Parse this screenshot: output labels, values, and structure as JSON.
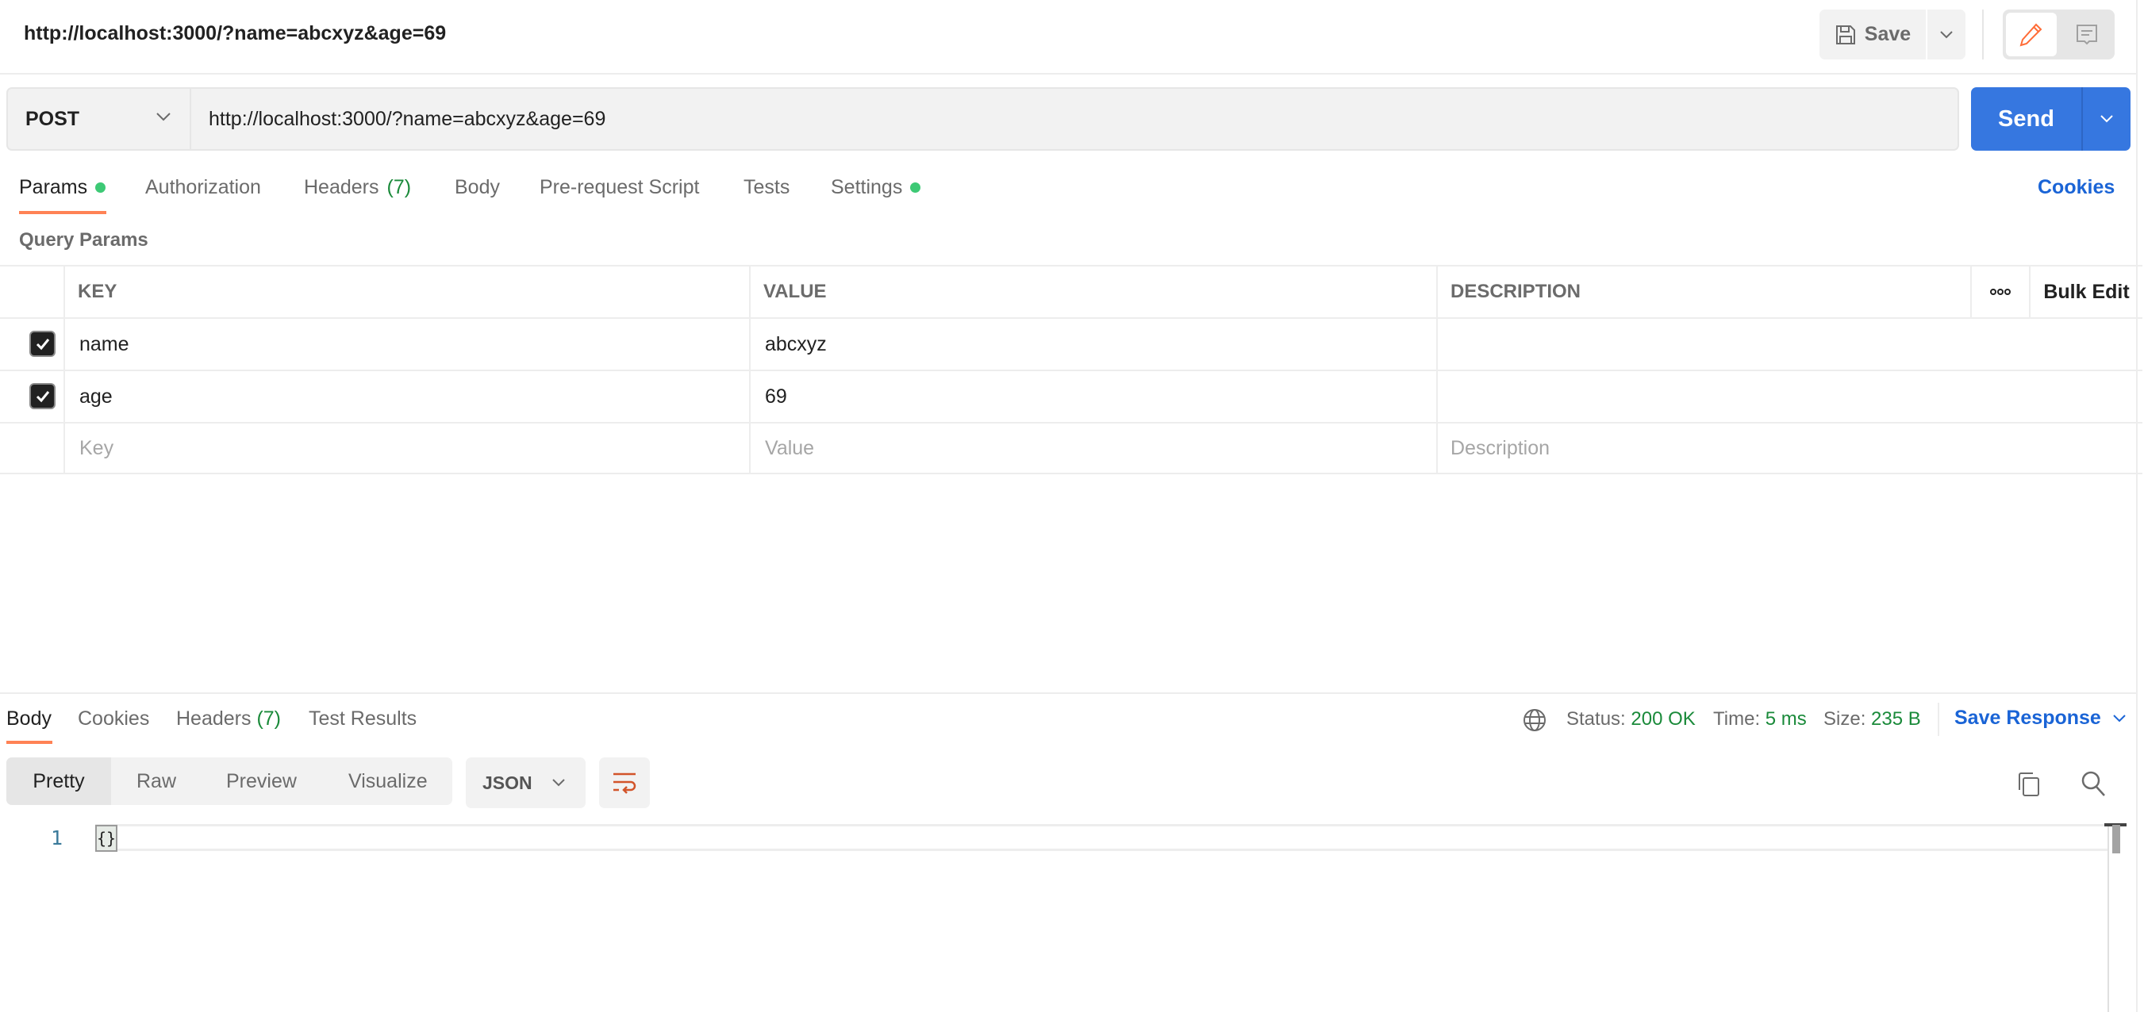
{
  "header": {
    "title": "http://localhost:3000/?name=abcxyz&age=69",
    "save_label": "Save",
    "icons": {
      "save": "floppy-disk-icon",
      "dropdown": "chevron-down-icon",
      "edit": "pencil-icon",
      "comments": "comment-icon"
    }
  },
  "request": {
    "method": "POST",
    "url": "http://localhost:3000/?name=abcxyz&age=69",
    "send_label": "Send"
  },
  "request_tabs": [
    {
      "label": "Params",
      "active": true,
      "dot": true
    },
    {
      "label": "Authorization"
    },
    {
      "label": "Headers",
      "count": "(7)"
    },
    {
      "label": "Body"
    },
    {
      "label": "Pre-request Script"
    },
    {
      "label": "Tests"
    },
    {
      "label": "Settings",
      "dot": true
    }
  ],
  "cookies_link": "Cookies",
  "query_params": {
    "title": "Query Params",
    "columns": [
      "KEY",
      "VALUE",
      "DESCRIPTION"
    ],
    "more_label": "ooo",
    "bulk_edit_label": "Bulk Edit",
    "rows": [
      {
        "checked": true,
        "key": "name",
        "value": "abcxyz",
        "description": ""
      },
      {
        "checked": true,
        "key": "age",
        "value": "69",
        "description": ""
      }
    ],
    "placeholders": {
      "key": "Key",
      "value": "Value",
      "description": "Description"
    }
  },
  "response": {
    "tabs": [
      {
        "label": "Body",
        "active": true
      },
      {
        "label": "Cookies"
      },
      {
        "label": "Headers",
        "count": "(7)"
      },
      {
        "label": "Test Results"
      }
    ],
    "status_label": "Status:",
    "status_value": "200 OK",
    "time_label": "Time:",
    "time_value": "5 ms",
    "size_label": "Size:",
    "size_value": "235 B",
    "save_response_label": "Save Response",
    "view_modes": [
      "Pretty",
      "Raw",
      "Preview",
      "Visualize"
    ],
    "active_view": "Pretty",
    "language": "JSON",
    "code_lines": [
      {
        "number": "1",
        "text": "{}"
      }
    ],
    "colors": {
      "accent": "#ff6c37",
      "send": "#3677e0",
      "link": "#1a64d6",
      "success": "#1a8a3a"
    }
  }
}
